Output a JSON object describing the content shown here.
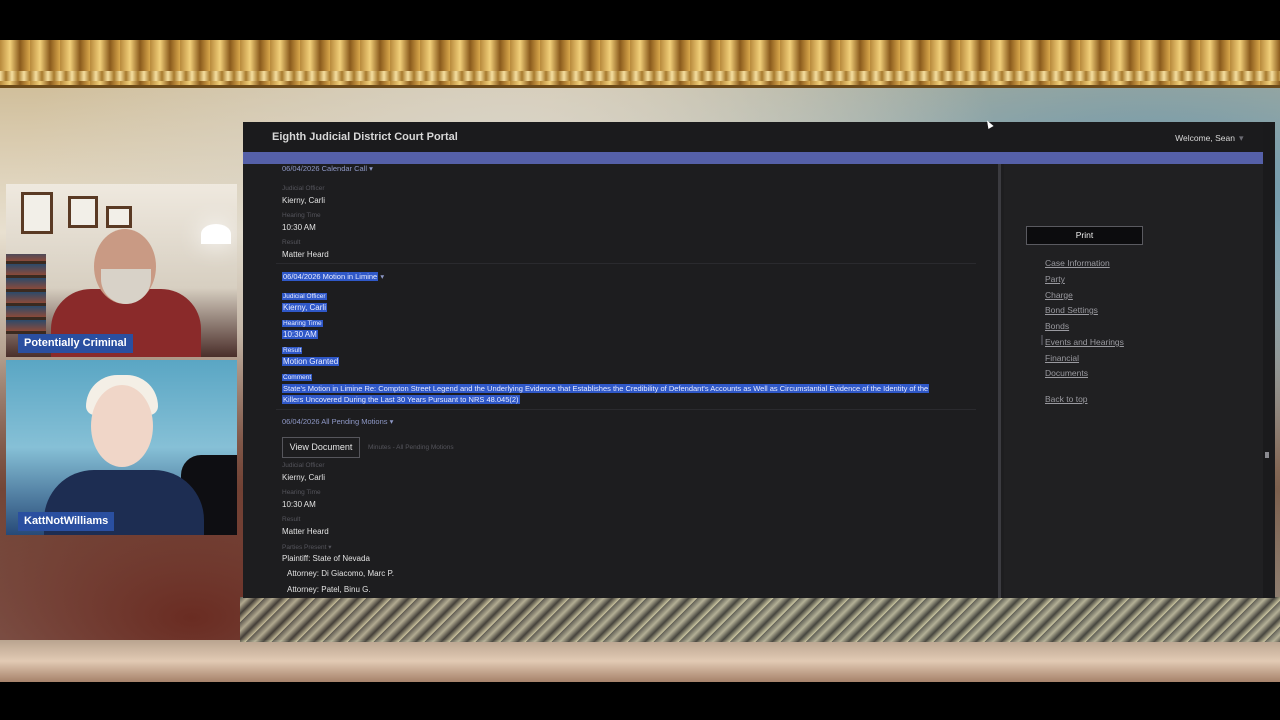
{
  "cams": [
    {
      "label": "Potentially Criminal"
    },
    {
      "label": "KattNotWilliams"
    }
  ],
  "portal": {
    "title": "Eighth Judicial District Court Portal",
    "welcome": "Welcome, Sean"
  },
  "events": {
    "e1": {
      "header": "06/04/2026 Calendar Call",
      "judicial_label": "Judicial Officer",
      "judicial_value": "Kierny, Carli",
      "time_label": "Hearing Time",
      "time_value": "10:30 AM",
      "result_label": "Result",
      "result_value": "Matter Heard"
    },
    "e2": {
      "header": "06/04/2026 Motion in Limine",
      "judicial_label": "Judicial Officer",
      "judicial_value": "Kierny, Carli",
      "time_label": "Hearing Time",
      "time_value": "10:30 AM",
      "result_label": "Result",
      "result_value": "Motion Granted",
      "comment_label": "Comment",
      "comment_line1": "State's Motion in Limine Re: Compton Street Legend and the Underlying Evidence that Establishes the Credibility of Defendant's Accounts as Well as Circumstantial Evidence of the Identity of the",
      "comment_line2": "Killers Uncovered During the Last 30 Years Pursuant to NRS 48.045(2)"
    },
    "e3": {
      "header": "06/04/2026 All Pending Motions",
      "view_doc": "View Document",
      "doc_sub": "Minutes - All Pending Motions",
      "judicial_label": "Judicial Officer",
      "judicial_value": "Kierny, Carli",
      "time_label": "Hearing Time",
      "time_value": "10:30 AM",
      "result_label": "Result",
      "result_value": "Matter Heard",
      "parties_label": "Parties Present",
      "party1": "Plaintiff: State of Nevada",
      "attorney1": "Attorney: Di Giacomo, Marc P.",
      "attorney2": "Attorney: Patel, Binu G."
    }
  },
  "sidebar": {
    "print": "Print",
    "nav": [
      "Case Information",
      "Party",
      "Charge",
      "Bond Settings",
      "Bonds",
      "Events and Hearings",
      "Financial",
      "Documents"
    ],
    "back_to_top": "Back to top"
  }
}
